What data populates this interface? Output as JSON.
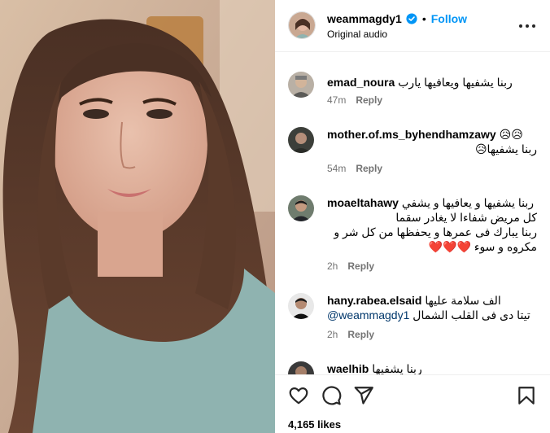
{
  "post": {
    "username": "weammagdy1",
    "separator": "•",
    "follow_label": "Follow",
    "audio": "Original audio"
  },
  "comments": [
    {
      "user": "emad_noura",
      "text": "ربنا يشفيها ويعافيها يارب",
      "time": "47m",
      "reply": "Reply"
    },
    {
      "user": "mother.of.ms_byhendhamzawy",
      "user_suffix": "😥😥",
      "text": "ربنا يشفيها😥",
      "time": "54m",
      "reply": "Reply"
    },
    {
      "user": "moaeltahawy",
      "text_line1": "ربنا يشفيها و يعافيها و يشفي",
      "text_line2": "كل مريض شفاءا لا يغادر سقما",
      "text_line3": "ربنا يبارك فى عمرها و يحفظها من كل شر و",
      "text_line4": "مكروه و سوء ❤️❤️❤️",
      "time": "2h",
      "reply": "Reply"
    },
    {
      "user": "hany.rabea.elsaid",
      "text_line1": "الف سلامة عليها",
      "mention": "@weammagdy1",
      "text_line2": "تيتا دى فى القلب الشمال",
      "time": "2h",
      "reply": "Reply"
    },
    {
      "user": "waelhib",
      "text": "ربنا يشفيها"
    }
  ],
  "likes": "4,165 likes",
  "icons": {
    "like": "heart-icon",
    "comment": "comment-bubble-icon",
    "share": "paper-plane-icon",
    "save": "bookmark-icon",
    "verified": "verified-badge-icon",
    "more": "more-options-icon"
  },
  "colors": {
    "accent": "#0095f6",
    "meta": "#737373",
    "heart": "#ed4956"
  }
}
